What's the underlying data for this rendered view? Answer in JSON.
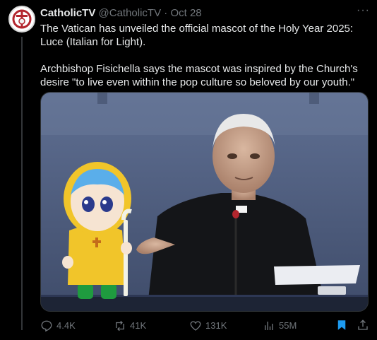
{
  "tweet": {
    "author_name": "CatholicTV",
    "author_handle": "@CatholicTV",
    "separator": "·",
    "date": "Oct 28",
    "more_label": "···",
    "paragraphs": [
      "The Vatican has unveiled the official mascot of the Holy Year 2025: Luce (Italian for Light).",
      "Archbishop Fisichella says the mascot was inspired by the Church's desire \"to live even within the pop culture so beloved by our youth.\""
    ]
  },
  "actions": {
    "replies": "4.4K",
    "reposts": "41K",
    "likes": "131K",
    "views": "55M"
  },
  "colors": {
    "background": "#000000",
    "text": "#e7e9ea",
    "muted": "#71767b",
    "bookmark_active": "#1d9bf0"
  },
  "icons": {
    "reply": "speech-bubble-icon",
    "repost": "repost-arrows-icon",
    "like": "heart-icon",
    "views": "bar-chart-icon",
    "bookmark": "bookmark-icon",
    "share": "share-upload-icon"
  }
}
